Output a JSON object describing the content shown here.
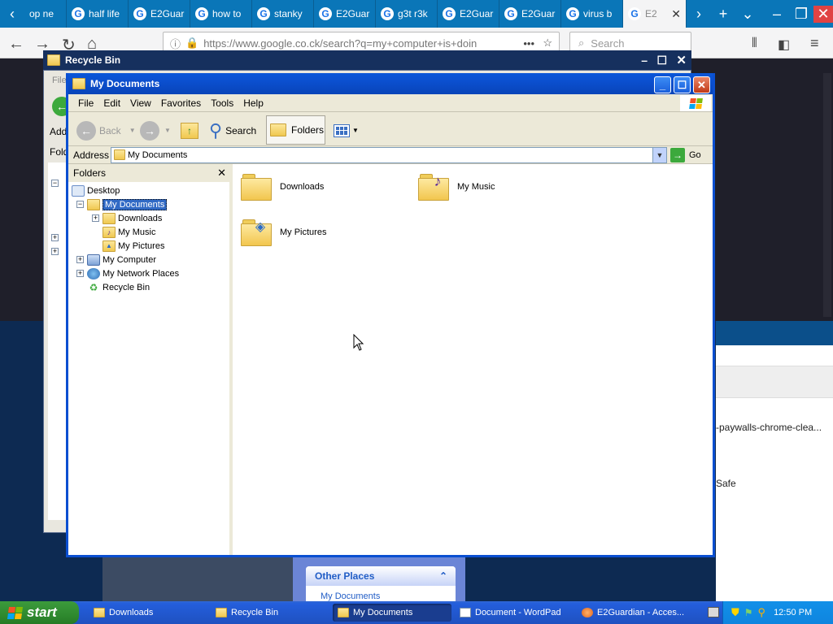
{
  "browser": {
    "tabs": [
      {
        "label": "op ne",
        "icon": "generic"
      },
      {
        "label": "half life",
        "icon": "google"
      },
      {
        "label": "E2Guar",
        "icon": "google"
      },
      {
        "label": "how to",
        "icon": "google"
      },
      {
        "label": "stanky",
        "icon": "google"
      },
      {
        "label": "E2Guar",
        "icon": "google"
      },
      {
        "label": "g3t r3k",
        "icon": "google"
      },
      {
        "label": "E2Guar",
        "icon": "google"
      },
      {
        "label": "E2Guar",
        "icon": "google"
      },
      {
        "label": "virus b",
        "icon": "google"
      },
      {
        "label": "E2",
        "icon": "google",
        "active": true
      }
    ],
    "url": "https://www.google.co.ck/search?q=my+computer+is+doin",
    "search_placeholder": "Search",
    "background_text": {
      "snippet1": "-paywalls-chrome-clea...",
      "snippet2": "Safe"
    }
  },
  "recycle_bin_window": {
    "title": "Recycle Bin",
    "menu_fragment": "File",
    "address_fragment": "Add",
    "folders_fragment": "Fold"
  },
  "my_documents_window": {
    "title": "My Documents",
    "menu": [
      "File",
      "Edit",
      "View",
      "Favorites",
      "Tools",
      "Help"
    ],
    "toolbar": {
      "back_label": "Back",
      "search_label": "Search",
      "folders_label": "Folders"
    },
    "address": {
      "label": "Address",
      "value": "My Documents",
      "go_label": "Go"
    },
    "folders_pane": {
      "header": "Folders",
      "tree": [
        {
          "label": "Desktop",
          "level": 0
        },
        {
          "label": "My Documents",
          "level": 1,
          "selected": true,
          "expander": "-"
        },
        {
          "label": "Downloads",
          "level": 2,
          "expander": "+"
        },
        {
          "label": "My Music",
          "level": 2
        },
        {
          "label": "My Pictures",
          "level": 2
        },
        {
          "label": "My Computer",
          "level": 1,
          "expander": "+"
        },
        {
          "label": "My Network Places",
          "level": 1,
          "expander": "+"
        },
        {
          "label": "Recycle Bin",
          "level": 1
        }
      ]
    },
    "items": [
      {
        "label": "Downloads",
        "type": "folder"
      },
      {
        "label": "My Music",
        "type": "music-folder"
      },
      {
        "label": "My Pictures",
        "type": "pictures-folder"
      }
    ]
  },
  "other_places": {
    "header": "Other Places",
    "item": "My Documents"
  },
  "taskbar": {
    "start_label": "start",
    "tasks": [
      {
        "label": "Downloads"
      },
      {
        "label": "Recycle Bin"
      },
      {
        "label": "My Documents",
        "active": true
      },
      {
        "label": "Document - WordPad"
      },
      {
        "label": "E2Guardian - Acces..."
      }
    ],
    "clock": "12:50 PM"
  },
  "colors": {
    "xp_blue": "#0a56d8",
    "start_green": "#2f8a2f",
    "firefox_tabstrip": "#0a76b8",
    "selection": "#316ac5"
  }
}
